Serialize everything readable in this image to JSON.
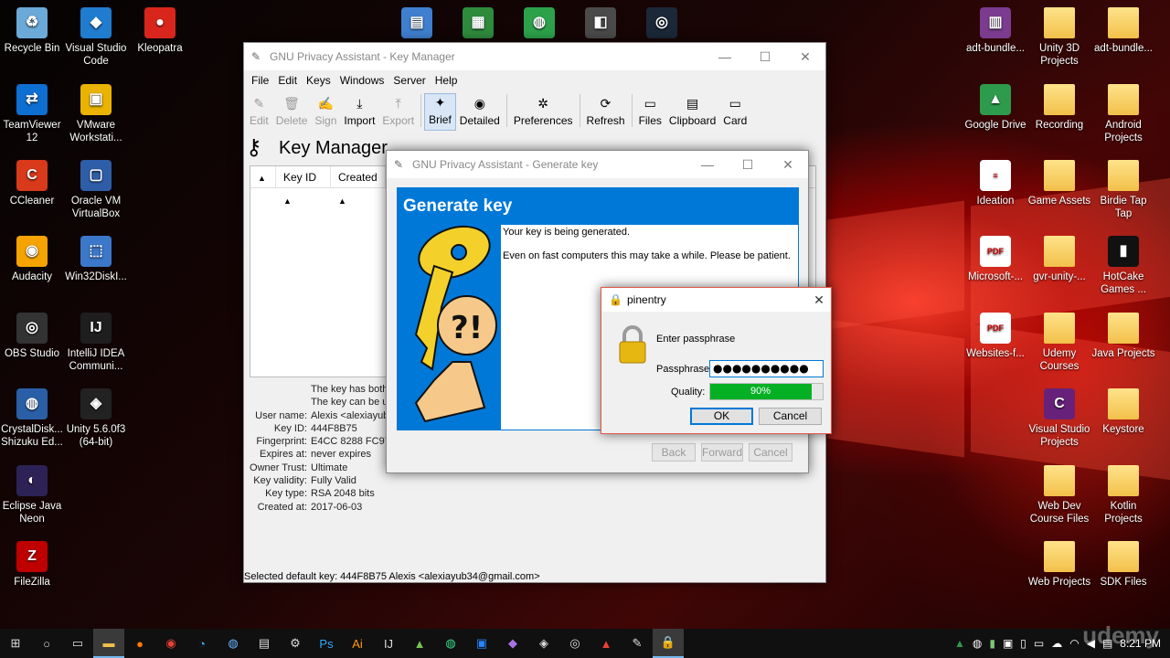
{
  "desktop": {
    "left_icons": [
      {
        "label": "Recycle Bin",
        "color": "#6aa9d8",
        "glyph": "♻"
      },
      {
        "label": "Visual Studio Code",
        "color": "#1f7ccf",
        "glyph": "◆"
      },
      {
        "label": "Kleopatra",
        "color": "#d9261c",
        "glyph": "●"
      },
      {
        "label": "TeamViewer 12",
        "color": "#0e6fd2",
        "glyph": "⇄"
      },
      {
        "label": "VMware Workstati...",
        "color": "#e9b300",
        "glyph": "▣"
      },
      {
        "label": "CCleaner",
        "color": "#d93a1b",
        "glyph": "C"
      },
      {
        "label": "Oracle VM VirtualBox",
        "color": "#2f5ea8",
        "glyph": "▢"
      },
      {
        "label": "Audacity",
        "color": "#f5a300",
        "glyph": "◉"
      },
      {
        "label": "Win32DiskI...",
        "color": "#3b78c9",
        "glyph": "⬚"
      },
      {
        "label": "OBS Studio",
        "color": "#333333",
        "glyph": "◎"
      },
      {
        "label": "IntelliJ IDEA Communi...",
        "color": "#1e1e1e",
        "glyph": "IJ"
      },
      {
        "label": "CrystalDisk... Shizuku Ed...",
        "color": "#2a5fa8",
        "glyph": "◍"
      },
      {
        "label": "Unity 5.6.0f3 (64-bit)",
        "color": "#222222",
        "glyph": "◈"
      },
      {
        "label": "Eclipse Java Neon",
        "color": "#2c2255",
        "glyph": "◐"
      },
      {
        "label": "FileZilla",
        "color": "#bf0000",
        "glyph": "Z"
      }
    ],
    "top_icons": [
      {
        "label": "",
        "color": "#3f7fd0",
        "glyph": "▤"
      },
      {
        "label": "",
        "color": "#2e8b3c",
        "glyph": "▦"
      },
      {
        "label": "",
        "color": "#2ca14a",
        "glyph": "◍"
      },
      {
        "label": "",
        "color": "#4a4a4a",
        "glyph": "◧"
      },
      {
        "label": "",
        "color": "#1b2838",
        "glyph": "◎"
      }
    ],
    "right_icons": [
      {
        "label": "adt-bundle...",
        "type": "app",
        "color": "#7b3b8e",
        "glyph": "▥"
      },
      {
        "label": "Unity 3D Projects",
        "type": "folder"
      },
      {
        "label": "adt-bundle...",
        "type": "folder"
      },
      {
        "label": "Google Drive",
        "type": "app",
        "color": "#2d9b4b",
        "glyph": "▲"
      },
      {
        "label": "Recording",
        "type": "folder"
      },
      {
        "label": "Android Projects",
        "type": "folder"
      },
      {
        "label": "Ideation",
        "type": "file",
        "glyph": "≡"
      },
      {
        "label": "Game Assets",
        "type": "folder"
      },
      {
        "label": "Birdie Tap Tap",
        "type": "folder"
      },
      {
        "label": "Microsoft-...",
        "type": "file",
        "glyph": "PDF"
      },
      {
        "label": "gvr-unity-...",
        "type": "folder"
      },
      {
        "label": "HotCake Games ...",
        "type": "app",
        "color": "#111111",
        "glyph": "▮"
      },
      {
        "label": "Websites-f...",
        "type": "file",
        "glyph": "PDF"
      },
      {
        "label": "Udemy Courses",
        "type": "folder"
      },
      {
        "label": "Java Projects",
        "type": "folder"
      },
      {
        "label": "Visual Studio Projects",
        "type": "app",
        "color": "#68217a",
        "glyph": "C"
      },
      {
        "label": "Keystore",
        "type": "folder"
      },
      {
        "label": "Web Dev Course Files",
        "type": "folder"
      },
      {
        "label": "Kotlin Projects",
        "type": "folder"
      },
      {
        "label": "Web Projects",
        "type": "folder"
      },
      {
        "label": "SDK Files",
        "type": "folder"
      }
    ]
  },
  "key_manager": {
    "title": "GNU Privacy Assistant - Key Manager",
    "menu": [
      "File",
      "Edit",
      "Keys",
      "Windows",
      "Server",
      "Help"
    ],
    "toolbar": [
      {
        "label": "Edit",
        "icon": "pencil-icon",
        "glyph": "✎",
        "disabled": true
      },
      {
        "label": "Delete",
        "icon": "trash-icon",
        "glyph": "🗑",
        "disabled": true
      },
      {
        "label": "Sign",
        "icon": "sign-icon",
        "glyph": "✍",
        "disabled": true
      },
      {
        "label": "Import",
        "icon": "import-icon",
        "glyph": "⤓",
        "disabled": false
      },
      {
        "label": "Export",
        "icon": "export-icon",
        "glyph": "⤒",
        "disabled": true
      },
      {
        "label": "Brief",
        "icon": "brief-icon",
        "glyph": "✦",
        "disabled": false,
        "active": true
      },
      {
        "label": "Detailed",
        "icon": "detailed-icon",
        "glyph": "◉",
        "disabled": false
      },
      {
        "label": "Preferences",
        "icon": "preferences-icon",
        "glyph": "✲",
        "disabled": false
      },
      {
        "label": "Refresh",
        "icon": "refresh-icon",
        "glyph": "⟳",
        "disabled": false
      },
      {
        "label": "Files",
        "icon": "folder-icon",
        "glyph": "▭",
        "disabled": false
      },
      {
        "label": "Clipboard",
        "icon": "clipboard-icon",
        "glyph": "▤",
        "disabled": false
      },
      {
        "label": "Card",
        "icon": "card-icon",
        "glyph": "▭",
        "disabled": false
      }
    ],
    "heading": "Key Manager",
    "columns": [
      "",
      "Key ID",
      "Created"
    ],
    "details": [
      {
        "label": "",
        "value": "The key has both"
      },
      {
        "label": "",
        "value": "The key can be u"
      },
      {
        "label": "User name:",
        "value": "Alexis <alexiayub"
      },
      {
        "label": "Key ID:",
        "value": "444F8B75"
      },
      {
        "label": "Fingerprint:",
        "value": "E4CC 8288 FC97"
      },
      {
        "label": "Expires at:",
        "value": "never expires"
      },
      {
        "label": "Owner Trust:",
        "value": "Ultimate"
      },
      {
        "label": "Key validity:",
        "value": "Fully Valid"
      },
      {
        "label": "Key type:",
        "value": "RSA 2048 bits"
      },
      {
        "label": "Created at:",
        "value": "2017-06-03"
      }
    ],
    "status": "Selected default key: 444F8B75 Alexis <alexiayub34@gmail.com>"
  },
  "generate_key": {
    "title": "GNU Privacy Assistant - Generate key",
    "banner": "Generate key",
    "line1": "Your key is being generated.",
    "line2": "Even on fast computers this may take a while. Please be patient.",
    "back": "Back",
    "forward": "Forward",
    "cancel": "Cancel"
  },
  "pinentry": {
    "title": "pinentry",
    "prompt": "Enter passphrase",
    "passphrase_label": "Passphrase",
    "passphrase_value": "●●●●●●●●●●",
    "quality_label": "Quality:",
    "quality_text": "90%",
    "quality_percent": 90,
    "ok": "OK",
    "cancel": "Cancel"
  },
  "taskbar": {
    "clock": "8:21 PM",
    "watermark": "udemy"
  }
}
